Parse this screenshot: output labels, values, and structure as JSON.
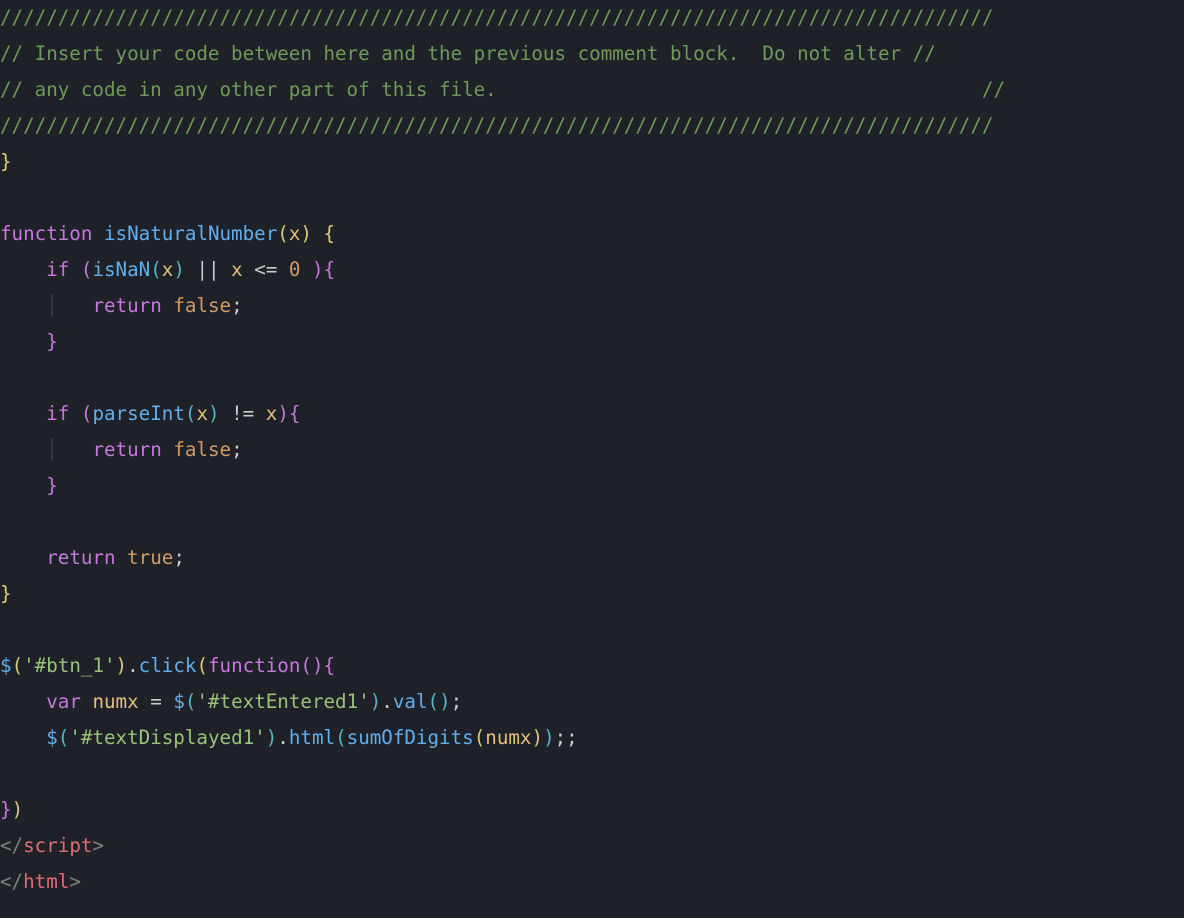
{
  "lines": [
    [
      {
        "cls": "c-comment",
        "t": "//////////////////////////////////////////////////////////////////////////////////////"
      }
    ],
    [
      {
        "cls": "c-comment",
        "t": "// Insert your code between here and the previous comment block.  Do not alter //"
      }
    ],
    [
      {
        "cls": "c-comment",
        "t": "// any code in any other part of this file.                                          //"
      }
    ],
    [
      {
        "cls": "c-comment",
        "t": "//////////////////////////////////////////////////////////////////////////////////////"
      }
    ],
    [
      {
        "cls": "c-brace",
        "t": "}"
      }
    ],
    [
      {
        "cls": "c-plain",
        "t": ""
      }
    ],
    [
      {
        "cls": "c-key",
        "t": "function"
      },
      {
        "cls": "c-plain",
        "t": " "
      },
      {
        "cls": "c-func",
        "t": "isNaturalNumber"
      },
      {
        "cls": "c-brace",
        "t": "("
      },
      {
        "cls": "c-ident",
        "t": "x"
      },
      {
        "cls": "c-brace",
        "t": ")"
      },
      {
        "cls": "c-plain",
        "t": " "
      },
      {
        "cls": "c-brace",
        "t": "{"
      }
    ],
    [
      {
        "cls": "c-plain",
        "t": "    "
      },
      {
        "cls": "c-key",
        "t": "if"
      },
      {
        "cls": "c-plain",
        "t": " "
      },
      {
        "cls": "c-brace2",
        "t": "("
      },
      {
        "cls": "c-func",
        "t": "isNaN"
      },
      {
        "cls": "c-brace3",
        "t": "("
      },
      {
        "cls": "c-ident",
        "t": "x"
      },
      {
        "cls": "c-brace3",
        "t": ")"
      },
      {
        "cls": "c-plain",
        "t": " || "
      },
      {
        "cls": "c-ident",
        "t": "x"
      },
      {
        "cls": "c-plain",
        "t": " <= "
      },
      {
        "cls": "c-num",
        "t": "0"
      },
      {
        "cls": "c-plain",
        "t": " "
      },
      {
        "cls": "c-brace2",
        "t": ")"
      },
      {
        "cls": "c-brace2",
        "t": "{"
      }
    ],
    [
      {
        "cls": "c-plain",
        "t": "    "
      },
      {
        "cls": "c-guide",
        "t": "│"
      },
      {
        "cls": "c-plain",
        "t": "   "
      },
      {
        "cls": "c-key",
        "t": "return"
      },
      {
        "cls": "c-plain",
        "t": " "
      },
      {
        "cls": "c-bool",
        "t": "false"
      },
      {
        "cls": "c-plain",
        "t": ";"
      }
    ],
    [
      {
        "cls": "c-plain",
        "t": "    "
      },
      {
        "cls": "c-brace2",
        "t": "}"
      }
    ],
    [
      {
        "cls": "c-plain",
        "t": ""
      }
    ],
    [
      {
        "cls": "c-plain",
        "t": "    "
      },
      {
        "cls": "c-key",
        "t": "if"
      },
      {
        "cls": "c-plain",
        "t": " "
      },
      {
        "cls": "c-brace2",
        "t": "("
      },
      {
        "cls": "c-func",
        "t": "parseInt"
      },
      {
        "cls": "c-brace3",
        "t": "("
      },
      {
        "cls": "c-ident",
        "t": "x"
      },
      {
        "cls": "c-brace3",
        "t": ")"
      },
      {
        "cls": "c-plain",
        "t": " != "
      },
      {
        "cls": "c-ident",
        "t": "x"
      },
      {
        "cls": "c-brace2",
        "t": ")"
      },
      {
        "cls": "c-brace2",
        "t": "{"
      }
    ],
    [
      {
        "cls": "c-plain",
        "t": "    "
      },
      {
        "cls": "c-guide",
        "t": "│"
      },
      {
        "cls": "c-plain",
        "t": "   "
      },
      {
        "cls": "c-key",
        "t": "return"
      },
      {
        "cls": "c-plain",
        "t": " "
      },
      {
        "cls": "c-bool",
        "t": "false"
      },
      {
        "cls": "c-plain",
        "t": ";"
      }
    ],
    [
      {
        "cls": "c-plain",
        "t": "    "
      },
      {
        "cls": "c-brace2",
        "t": "}"
      }
    ],
    [
      {
        "cls": "c-plain",
        "t": ""
      }
    ],
    [
      {
        "cls": "c-plain",
        "t": "    "
      },
      {
        "cls": "c-key",
        "t": "return"
      },
      {
        "cls": "c-plain",
        "t": " "
      },
      {
        "cls": "c-bool",
        "t": "true"
      },
      {
        "cls": "c-plain",
        "t": ";"
      }
    ],
    [
      {
        "cls": "c-brace",
        "t": "}"
      }
    ],
    [
      {
        "cls": "c-plain",
        "t": ""
      }
    ],
    [
      {
        "cls": "c-func",
        "t": "$"
      },
      {
        "cls": "c-brace",
        "t": "("
      },
      {
        "cls": "c-str",
        "t": "'#btn_1'"
      },
      {
        "cls": "c-brace",
        "t": ")"
      },
      {
        "cls": "c-plain",
        "t": "."
      },
      {
        "cls": "c-func",
        "t": "click"
      },
      {
        "cls": "c-brace",
        "t": "("
      },
      {
        "cls": "c-key",
        "t": "function"
      },
      {
        "cls": "c-brace2",
        "t": "("
      },
      {
        "cls": "c-brace2",
        "t": ")"
      },
      {
        "cls": "c-brace2",
        "t": "{"
      }
    ],
    [
      {
        "cls": "c-plain",
        "t": "    "
      },
      {
        "cls": "c-key",
        "t": "var"
      },
      {
        "cls": "c-plain",
        "t": " "
      },
      {
        "cls": "c-ident",
        "t": "numx"
      },
      {
        "cls": "c-plain",
        "t": " = "
      },
      {
        "cls": "c-func",
        "t": "$"
      },
      {
        "cls": "c-brace3",
        "t": "("
      },
      {
        "cls": "c-str",
        "t": "'#textEntered1'"
      },
      {
        "cls": "c-brace3",
        "t": ")"
      },
      {
        "cls": "c-plain",
        "t": "."
      },
      {
        "cls": "c-func",
        "t": "val"
      },
      {
        "cls": "c-brace3",
        "t": "("
      },
      {
        "cls": "c-brace3",
        "t": ")"
      },
      {
        "cls": "c-plain",
        "t": ";"
      }
    ],
    [
      {
        "cls": "c-plain",
        "t": "    "
      },
      {
        "cls": "c-func",
        "t": "$"
      },
      {
        "cls": "c-brace3",
        "t": "("
      },
      {
        "cls": "c-str",
        "t": "'#textDisplayed1'"
      },
      {
        "cls": "c-brace3",
        "t": ")"
      },
      {
        "cls": "c-plain",
        "t": "."
      },
      {
        "cls": "c-func",
        "t": "html"
      },
      {
        "cls": "c-brace3",
        "t": "("
      },
      {
        "cls": "c-func",
        "t": "sumOfDigits"
      },
      {
        "cls": "c-brace",
        "t": "("
      },
      {
        "cls": "c-ident",
        "t": "numx"
      },
      {
        "cls": "c-brace",
        "t": ")"
      },
      {
        "cls": "c-brace3",
        "t": ")"
      },
      {
        "cls": "c-plain",
        "t": ";;"
      }
    ],
    [
      {
        "cls": "c-plain",
        "t": ""
      }
    ],
    [
      {
        "cls": "c-brace2",
        "t": "}"
      },
      {
        "cls": "c-brace",
        "t": ")"
      }
    ],
    [
      {
        "cls": "c-tagbr",
        "t": "</"
      },
      {
        "cls": "c-tag",
        "t": "script"
      },
      {
        "cls": "c-tagbr",
        "t": ">"
      }
    ],
    [
      {
        "cls": "c-tagbr",
        "t": "</"
      },
      {
        "cls": "c-tag",
        "t": "html"
      },
      {
        "cls": "c-tagbr",
        "t": ">"
      }
    ]
  ]
}
